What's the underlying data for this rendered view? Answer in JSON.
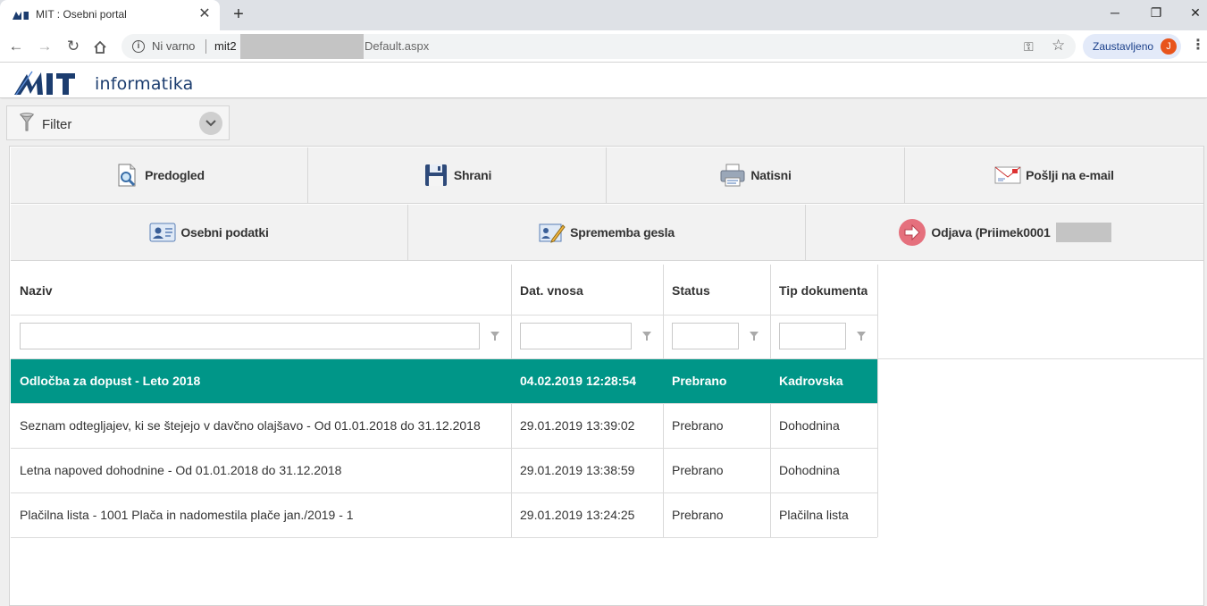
{
  "browser": {
    "tab_title": "MIT : Osebni portal",
    "security_text": "Ni varno",
    "url_prefix": "mit2",
    "url_suffix": "Default.aspx",
    "profile_label": "Zaustavljeno",
    "profile_initial": "J"
  },
  "header": {
    "logo_letters": "MIT",
    "logo_text": "informatika"
  },
  "filter": {
    "label": "Filter"
  },
  "toolbar": {
    "row1": [
      {
        "label": "Predogled",
        "icon": "preview-icon"
      },
      {
        "label": "Shrani",
        "icon": "floppy-disk-icon"
      },
      {
        "label": "Natisni",
        "icon": "printer-icon"
      },
      {
        "label": "Pošlji na e-mail",
        "icon": "envelope-icon"
      }
    ],
    "row2": [
      {
        "label": "Osebni podatki",
        "icon": "id-card-icon"
      },
      {
        "label": "Sprememba gesla",
        "icon": "edit-document-icon"
      },
      {
        "label": "Odjava (Priimek0001",
        "icon": "logout-arrow-icon"
      }
    ]
  },
  "table": {
    "columns": [
      "Naziv",
      "Dat. vnosa",
      "Status",
      "Tip dokumenta"
    ],
    "rows": [
      {
        "naziv": "Odločba za dopust - Leto 2018",
        "datum": "04.02.2019 12:28:54",
        "status": "Prebrano",
        "tip": "Kadrovska",
        "selected": true
      },
      {
        "naziv": "Seznam odtegljajev, ki se štejejo v davčno olajšavo - Od 01.01.2018 do 31.12.2018",
        "datum": "29.01.2019 13:39:02",
        "status": "Prebrano",
        "tip": "Dohodnina",
        "selected": false
      },
      {
        "naziv": "Letna napoved dohodnine - Od 01.01.2018 do 31.12.2018",
        "datum": "29.01.2019 13:38:59",
        "status": "Prebrano",
        "tip": "Dohodnina",
        "selected": false
      },
      {
        "naziv": "Plačilna lista - 1001 Plača in nadomestila plače jan./2019 - 1",
        "datum": "29.01.2019 13:24:25",
        "status": "Prebrano",
        "tip": "Plačilna lista",
        "selected": false
      }
    ]
  },
  "colors": {
    "selected_row": "#009688",
    "toolbar_bg": "#f2f2f2",
    "logo_blue": "#1c3d6f"
  }
}
